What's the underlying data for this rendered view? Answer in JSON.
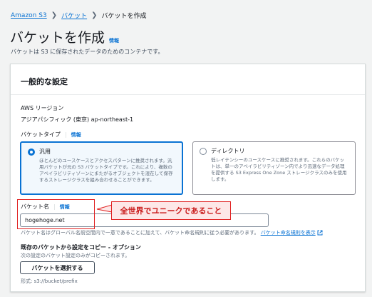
{
  "breadcrumb": {
    "items": [
      "Amazon S3",
      "バケット",
      "バケットを作成"
    ]
  },
  "page": {
    "title": "バケットを作成",
    "info": "情報",
    "description": "バケットは S3 に保存されたデータのためのコンテナです。"
  },
  "general": {
    "header": "一般的な設定",
    "region_label": "AWS リージョン",
    "region_value": "アジアパシフィック (東京) ap-northeast-1",
    "bucket_type_label": "バケットタイプ",
    "bucket_type_info": "情報",
    "options": [
      {
        "title": "汎用",
        "description": "ほとんどのユースケースとアクセスパターンに推奨されます。汎用バケットが元の S3 バケットタイプです。これにより、複数のアベイラビリティゾーンにまたがるオブジェクトを混在して保存するストレージクラスを組み合わせることができます。",
        "selected": true
      },
      {
        "title": "ディレクトリ",
        "description": "低レイテンシーのユースケースに推奨されます。これらのバケットは、単一のアベイラビリティゾーン内でより迅速なデータ処理を提供する S3 Express One Zone ストレージクラスのみを使用します。",
        "selected": false
      }
    ],
    "bucket_name_label": "バケット名",
    "bucket_name_info": "情報",
    "bucket_name_value": "hogehoge.net",
    "bucket_name_hint": "バケット名はグローバル名前空間内で一意であることに加えて、バケット命名規則に従う必要があります。",
    "naming_rules_link": "バケット命名規則を表示",
    "copy_title": "既存のバケットから設定をコピー - オプション",
    "copy_desc": "次の設定のバケット設定のみがコピーされます。",
    "choose_button": "バケットを選択する",
    "format_hint": "形式: s3://bucket/prefix"
  },
  "annotation": {
    "callout": "全世界でユニークであること"
  },
  "colors": {
    "link": "#0972d3",
    "annotation": "#e02020"
  }
}
